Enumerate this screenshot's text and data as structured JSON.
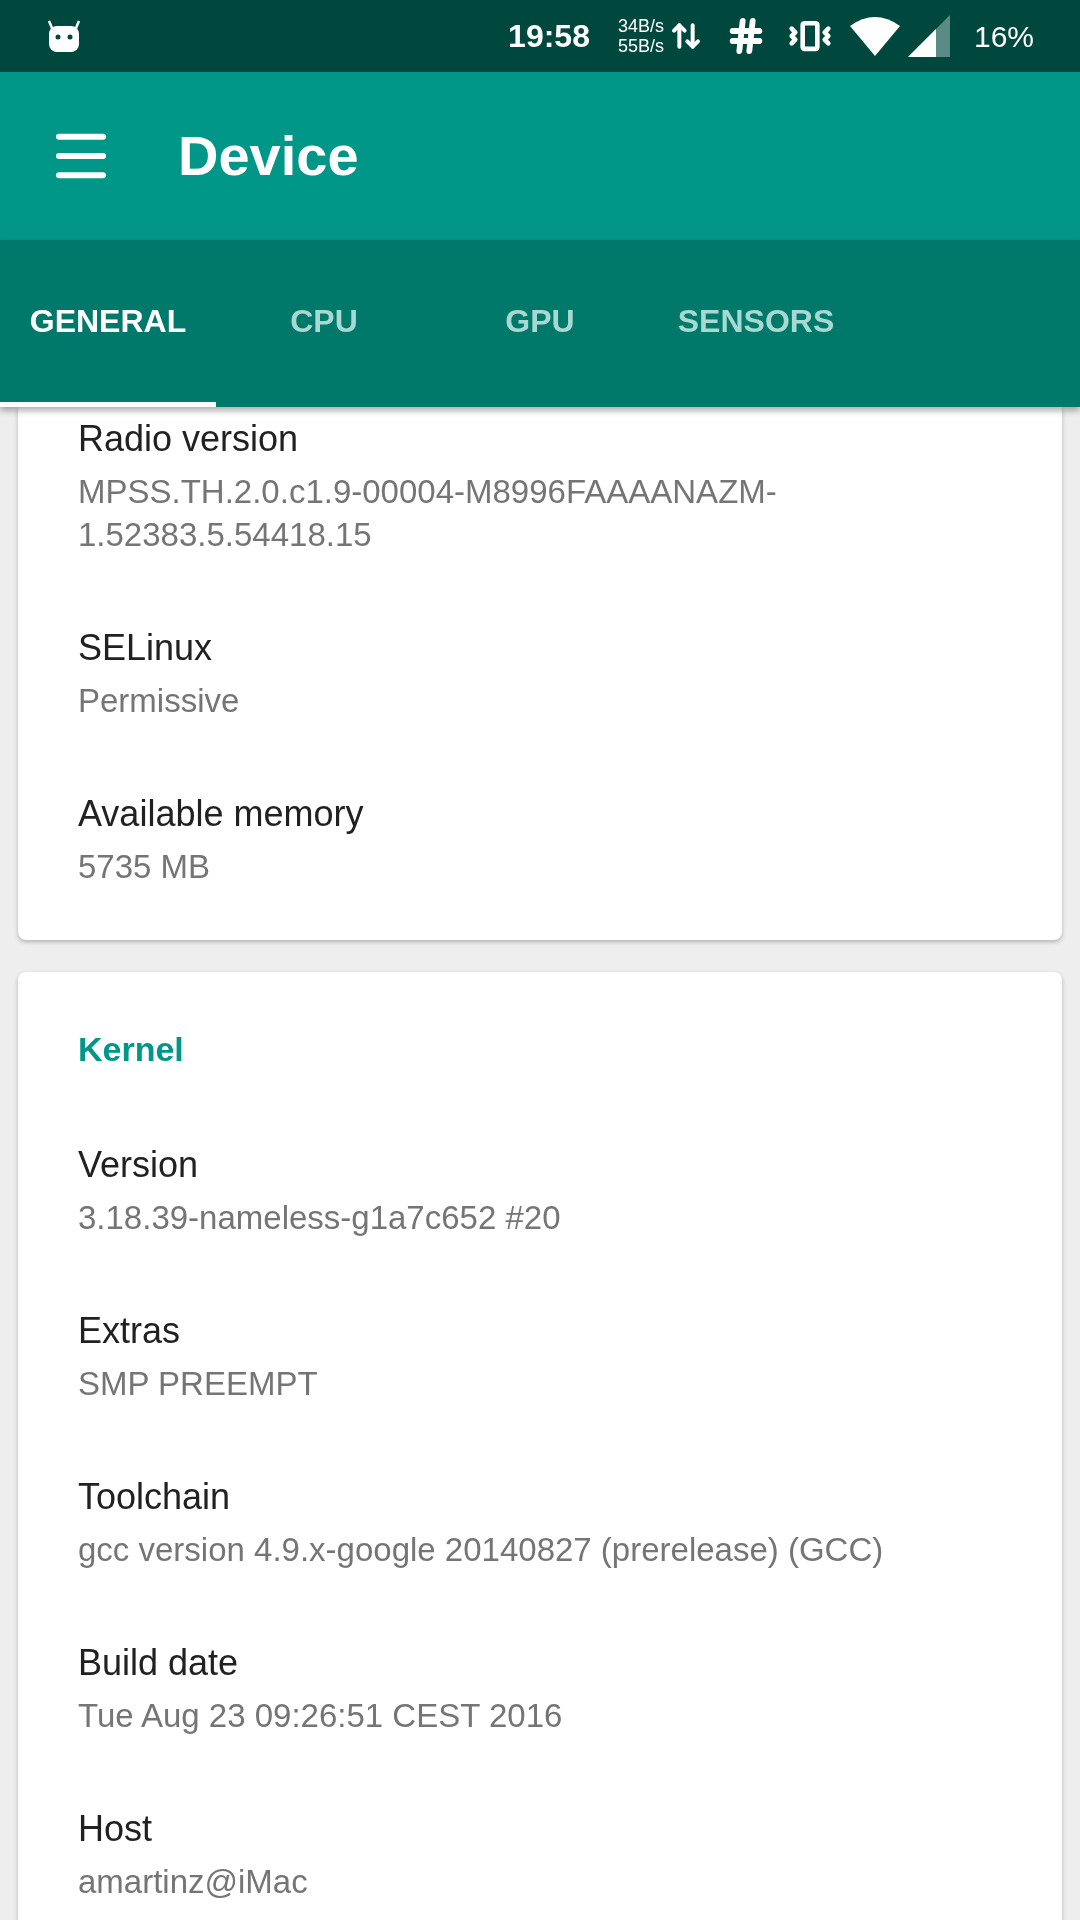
{
  "status_bar": {
    "time": "19:58",
    "upload_speed": "34B/s",
    "download_speed": "55B/s",
    "battery": "16%"
  },
  "app_bar": {
    "title": "Device"
  },
  "tabs": [
    {
      "label": "GENERAL",
      "selected": true
    },
    {
      "label": "CPU",
      "selected": false
    },
    {
      "label": "GPU",
      "selected": false
    },
    {
      "label": "SENSORS",
      "selected": false
    }
  ],
  "cards": [
    {
      "rows": [
        {
          "label": "Radio version",
          "value": "MPSS.TH.2.0.c1.9-00004-M8996FAAAANAZM-1.52383.5.54418.15"
        },
        {
          "label": "SELinux",
          "value": "Permissive"
        },
        {
          "label": "Available memory",
          "value": "5735 MB"
        }
      ]
    },
    {
      "heading": "Kernel",
      "rows": [
        {
          "label": "Version",
          "value": "3.18.39-nameless-g1a7c652 #20"
        },
        {
          "label": "Extras",
          "value": "SMP PREEMPT"
        },
        {
          "label": "Toolchain",
          "value": "gcc version 4.9.x-google 20140827 (prerelease) (GCC)"
        },
        {
          "label": "Build date",
          "value": "Tue Aug 23 09:26:51 CEST 2016"
        },
        {
          "label": "Host",
          "value": "amartinz@iMac"
        }
      ]
    }
  ]
}
